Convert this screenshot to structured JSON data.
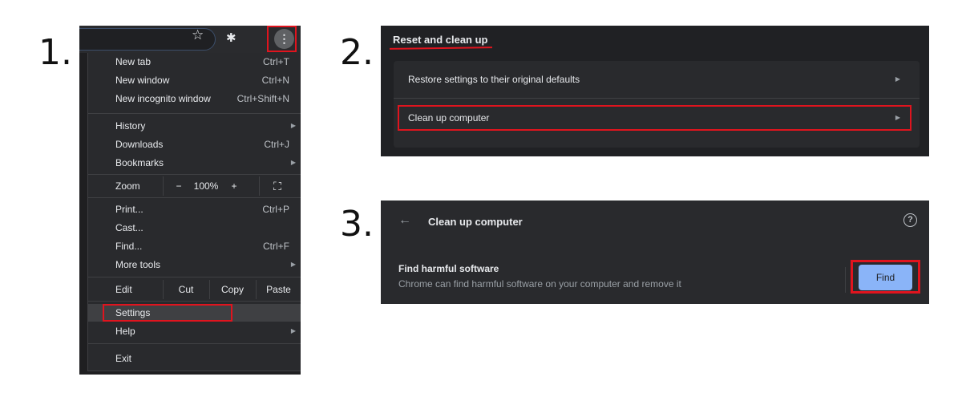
{
  "steps": [
    "1.",
    "2.",
    "3."
  ],
  "colors": {
    "highlight": "#e0141e",
    "find_button": "#8ab4f8",
    "panel_bg": "#292a2d"
  },
  "panel1": {
    "toolbar_icons": [
      "star-icon",
      "extensions-icon",
      "menu-kebab-icon"
    ],
    "star_glyph": "☆",
    "puzzle_glyph": "✱",
    "kebab_glyph": "⋮",
    "menu": {
      "new_tab": {
        "label": "New tab",
        "shortcut": "Ctrl+T"
      },
      "new_window": {
        "label": "New window",
        "shortcut": "Ctrl+N"
      },
      "new_incognito": {
        "label": "New incognito window",
        "shortcut": "Ctrl+Shift+N"
      },
      "history": {
        "label": "History"
      },
      "downloads": {
        "label": "Downloads",
        "shortcut": "Ctrl+J"
      },
      "bookmarks": {
        "label": "Bookmarks"
      },
      "zoom": {
        "label": "Zoom",
        "minus": "−",
        "value": "100%",
        "plus": "+",
        "fullscreen": "⛶"
      },
      "print": {
        "label": "Print...",
        "shortcut": "Ctrl+P"
      },
      "cast": {
        "label": "Cast..."
      },
      "find": {
        "label": "Find...",
        "shortcut": "Ctrl+F"
      },
      "more_tools": {
        "label": "More tools"
      },
      "edit": {
        "label": "Edit",
        "cut": "Cut",
        "copy": "Copy",
        "paste": "Paste"
      },
      "settings": {
        "label": "Settings"
      },
      "help": {
        "label": "Help"
      },
      "exit": {
        "label": "Exit"
      },
      "submenu_arrow": "▶"
    }
  },
  "panel2": {
    "section_title": "Reset and clean up",
    "rows": [
      {
        "label": "Restore settings to their original defaults"
      },
      {
        "label": "Clean up computer"
      }
    ],
    "arrow": "▶"
  },
  "panel3": {
    "back_glyph": "←",
    "title": "Clean up computer",
    "help_glyph": "?",
    "heading": "Find harmful software",
    "description": "Chrome can find harmful software on your computer and remove it",
    "button": "Find"
  }
}
